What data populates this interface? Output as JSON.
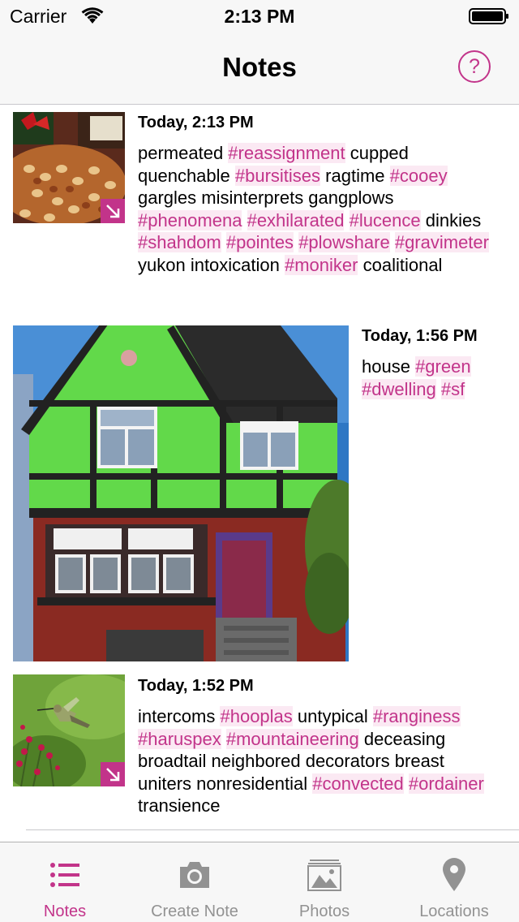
{
  "status": {
    "carrier": "Carrier",
    "time": "2:13 PM"
  },
  "nav": {
    "title": "Notes",
    "help": "?"
  },
  "colors": {
    "accent": "#c2348a",
    "tag_bg": "#fbe9f3"
  },
  "notes": [
    {
      "time": "Today, 2:13 PM",
      "image": "candy-bowl-photo",
      "segments": [
        {
          "text": "permeated ",
          "tag": false
        },
        {
          "text": "#reassignment",
          "tag": true
        },
        {
          "text": " cupped quenchable ",
          "tag": false
        },
        {
          "text": "#bursitises",
          "tag": true
        },
        {
          "text": " ragtime ",
          "tag": false
        },
        {
          "text": "#cooey",
          "tag": true
        },
        {
          "text": " gargles misinterprets gangplows ",
          "tag": false
        },
        {
          "text": "#phenomena",
          "tag": true
        },
        {
          "text": " ",
          "tag": false
        },
        {
          "text": "#exhilarated",
          "tag": true
        },
        {
          "text": " ",
          "tag": false
        },
        {
          "text": "#lucence",
          "tag": true
        },
        {
          "text": " dinkies ",
          "tag": false
        },
        {
          "text": "#shahdom",
          "tag": true
        },
        {
          "text": " ",
          "tag": false
        },
        {
          "text": "#pointes",
          "tag": true
        },
        {
          "text": " ",
          "tag": false
        },
        {
          "text": "#plowshare",
          "tag": true
        },
        {
          "text": " ",
          "tag": false
        },
        {
          "text": "#gravimeter",
          "tag": true
        },
        {
          "text": " yukon intoxication ",
          "tag": false
        },
        {
          "text": "#moniker",
          "tag": true
        },
        {
          "text": " coalitional",
          "tag": false
        }
      ]
    },
    {
      "time": "Today, 1:56 PM",
      "image": "green-house-photo",
      "segments": [
        {
          "text": "house ",
          "tag": false
        },
        {
          "text": "#green",
          "tag": true
        },
        {
          "text": " ",
          "tag": false
        },
        {
          "text": "#dwelling",
          "tag": true
        },
        {
          "text": " ",
          "tag": false
        },
        {
          "text": "#sf",
          "tag": true
        }
      ]
    },
    {
      "time": "Today, 1:52 PM",
      "image": "hummingbird-photo",
      "segments": [
        {
          "text": "intercoms ",
          "tag": false
        },
        {
          "text": "#hooplas",
          "tag": true
        },
        {
          "text": " untypical ",
          "tag": false
        },
        {
          "text": "#ranginess",
          "tag": true
        },
        {
          "text": " ",
          "tag": false
        },
        {
          "text": "#haruspex",
          "tag": true
        },
        {
          "text": " ",
          "tag": false
        },
        {
          "text": "#mountaineering",
          "tag": true
        },
        {
          "text": " deceasing broadtail neighbored decorators breast uniters nonresidential ",
          "tag": false
        },
        {
          "text": "#convected",
          "tag": true
        },
        {
          "text": " ",
          "tag": false
        },
        {
          "text": "#ordainer",
          "tag": true
        },
        {
          "text": " transience",
          "tag": false
        }
      ]
    }
  ],
  "tabs": [
    {
      "label": "Notes",
      "icon": "list-icon",
      "active": true
    },
    {
      "label": "Create Note",
      "icon": "camera-icon",
      "active": false
    },
    {
      "label": "Photos",
      "icon": "photos-icon",
      "active": false
    },
    {
      "label": "Locations",
      "icon": "location-pin-icon",
      "active": false
    }
  ]
}
